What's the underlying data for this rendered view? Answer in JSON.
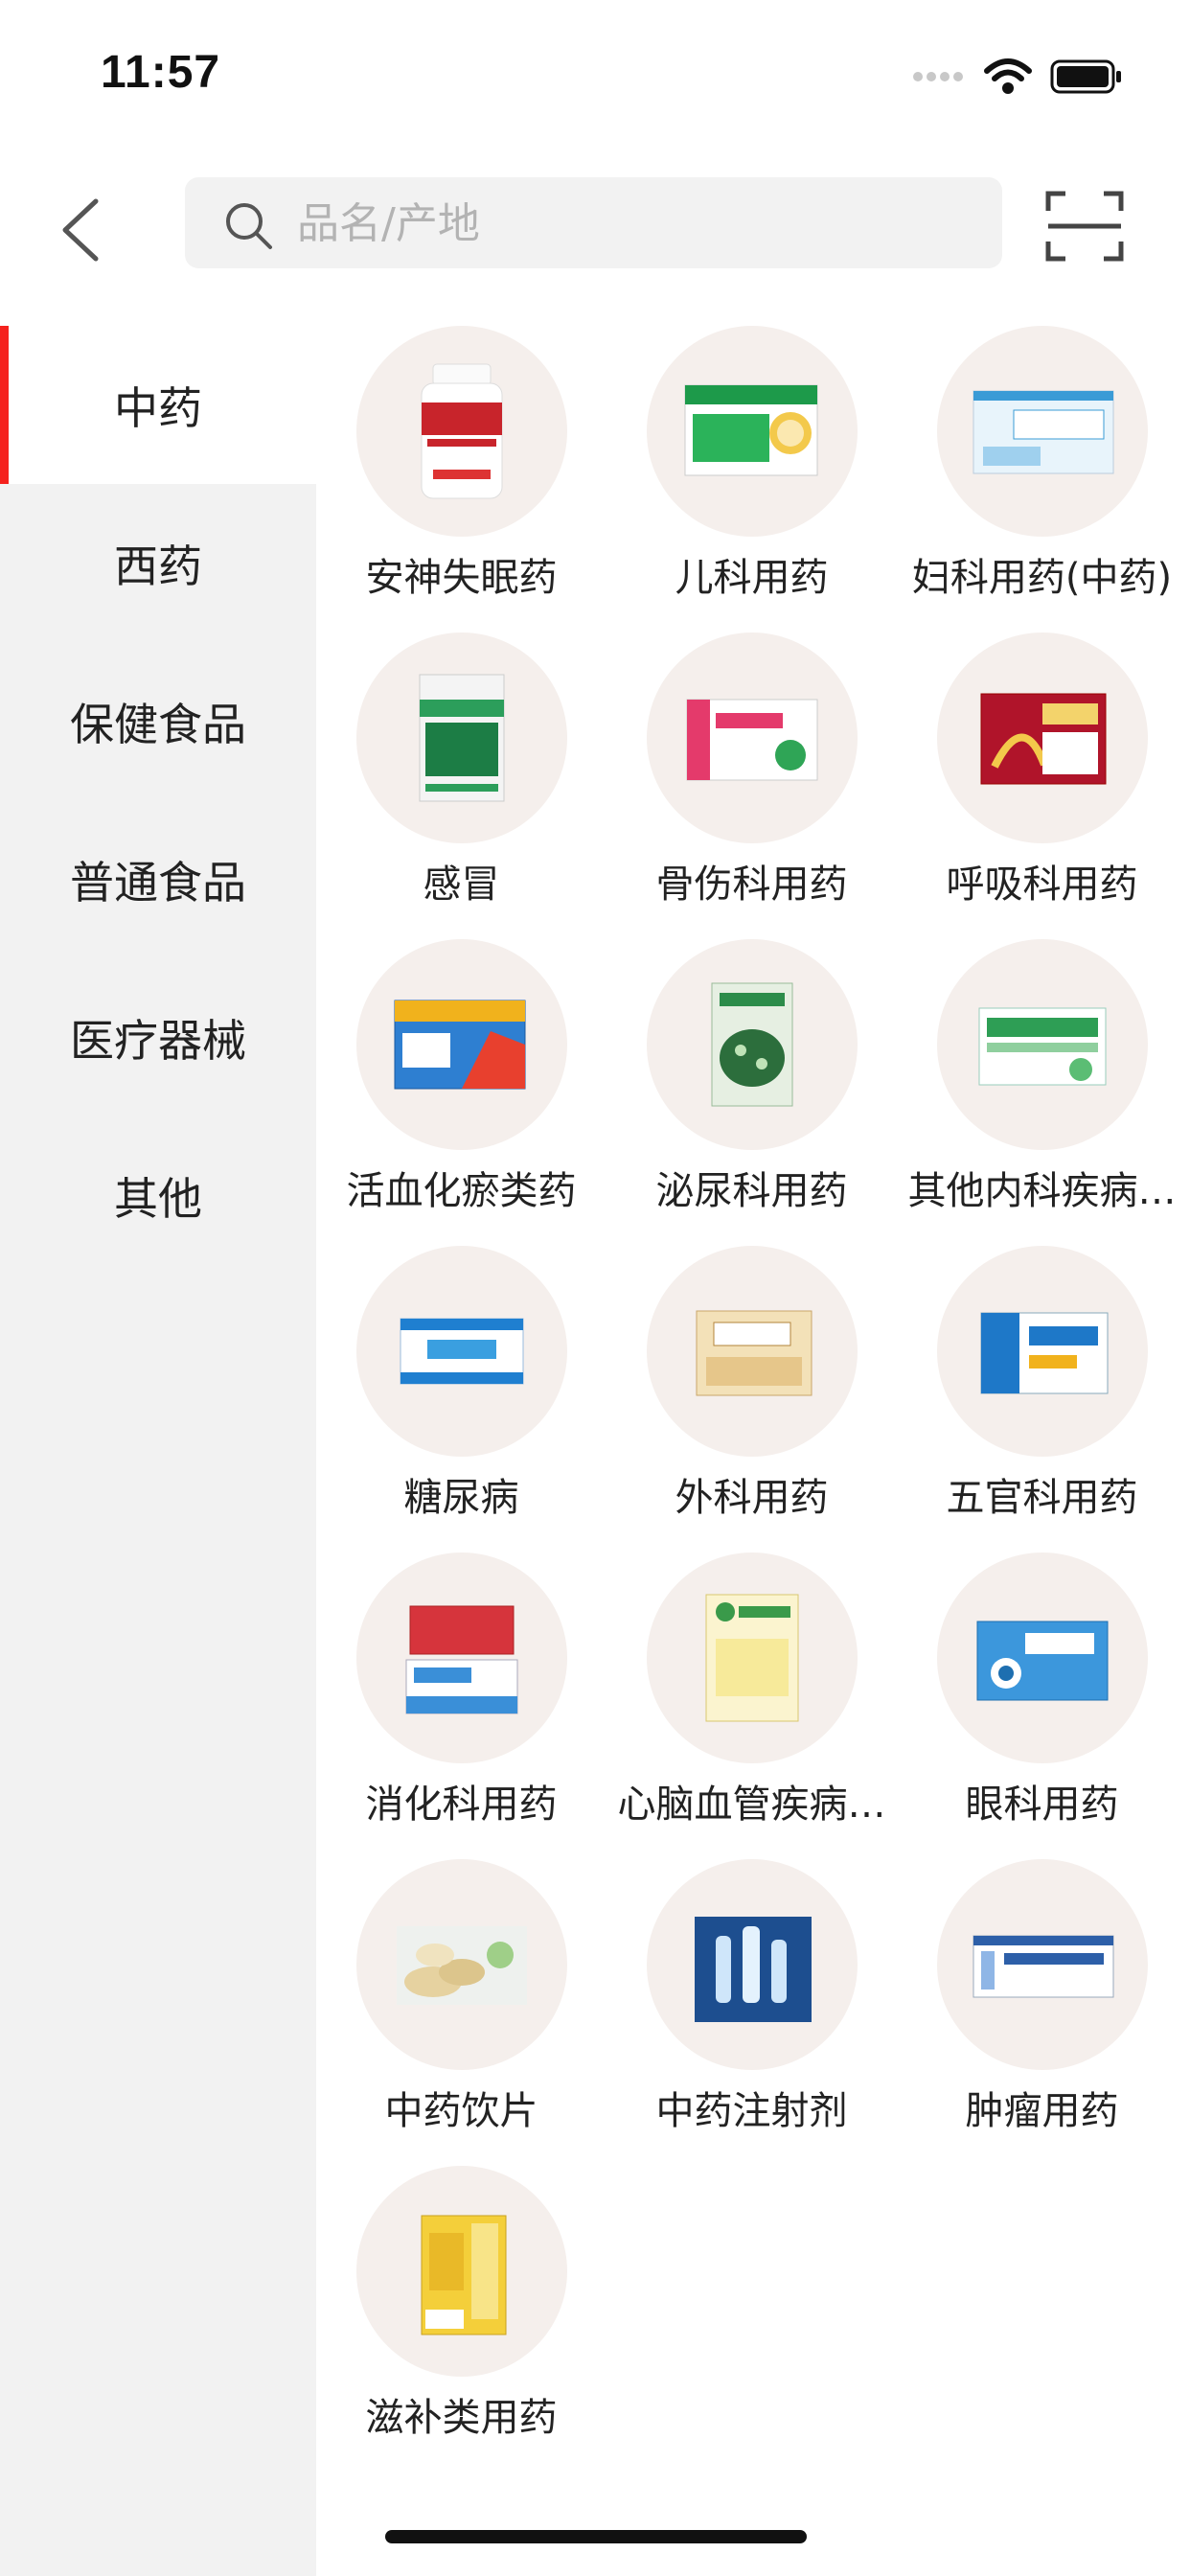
{
  "status_bar": {
    "time": "11:57"
  },
  "search": {
    "placeholder": "品名/产地",
    "value": ""
  },
  "sidebar": {
    "items": [
      {
        "label": "中药",
        "active": true
      },
      {
        "label": "西药",
        "active": false
      },
      {
        "label": "保健食品",
        "active": false
      },
      {
        "label": "普通食品",
        "active": false
      },
      {
        "label": "医疗器械",
        "active": false
      },
      {
        "label": "其他",
        "active": false
      }
    ]
  },
  "categories": [
    {
      "label": "安神失眠药",
      "icon": "medicine-bottle-image"
    },
    {
      "label": "儿科用药",
      "icon": "medicine-box-image"
    },
    {
      "label": "妇科用药(中药)",
      "icon": "medicine-box-image"
    },
    {
      "label": "感冒",
      "icon": "medicine-box-image"
    },
    {
      "label": "骨伤科用药",
      "icon": "medicine-box-image"
    },
    {
      "label": "呼吸科用药",
      "icon": "medicine-box-image"
    },
    {
      "label": "活血化瘀类药",
      "icon": "medicine-box-image"
    },
    {
      "label": "泌尿科用药",
      "icon": "medicine-pouch-image"
    },
    {
      "label": "其他内科疾病…",
      "icon": "medicine-box-image"
    },
    {
      "label": "糖尿病",
      "icon": "medicine-box-image"
    },
    {
      "label": "外科用药",
      "icon": "medicine-box-image"
    },
    {
      "label": "五官科用药",
      "icon": "medicine-box-image"
    },
    {
      "label": "消化科用药",
      "icon": "medicine-box-image"
    },
    {
      "label": "心脑血管疾病…",
      "icon": "medicine-box-image"
    },
    {
      "label": "眼科用药",
      "icon": "medicine-box-image"
    },
    {
      "label": "中药饮片",
      "icon": "herb-slices-image"
    },
    {
      "label": "中药注射剂",
      "icon": "injection-vials-image"
    },
    {
      "label": "肿瘤用药",
      "icon": "medicine-box-image"
    },
    {
      "label": "滋补类用药",
      "icon": "medicine-box-image"
    }
  ],
  "colors": {
    "accent": "#f5221d",
    "sidebar_bg": "#f2f2f2",
    "circle_bg": "#f5efec"
  }
}
